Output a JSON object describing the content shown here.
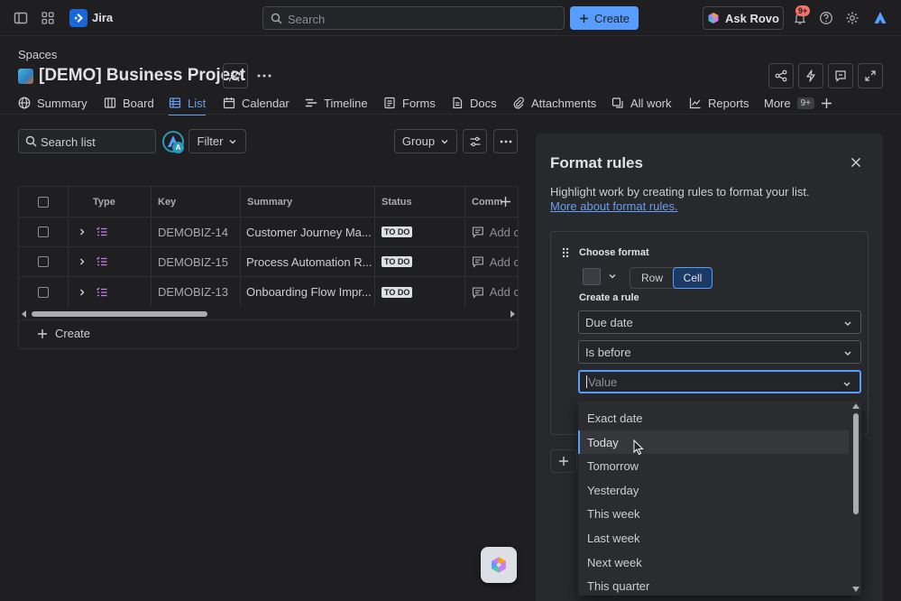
{
  "topbar": {
    "app_name": "Jira",
    "search_placeholder": "Search",
    "create_label": "Create",
    "ask_rovo_label": "Ask Rovo",
    "notification_count": "9+"
  },
  "header": {
    "spaces_label": "Spaces",
    "project_title": "[DEMO] Business Project"
  },
  "tabs": [
    {
      "label": "Summary",
      "icon": "globe-icon"
    },
    {
      "label": "Board",
      "icon": "board-icon"
    },
    {
      "label": "List",
      "icon": "list-icon",
      "active": true
    },
    {
      "label": "Calendar",
      "icon": "calendar-icon"
    },
    {
      "label": "Timeline",
      "icon": "timeline-icon"
    },
    {
      "label": "Forms",
      "icon": "forms-icon"
    },
    {
      "label": "Docs",
      "icon": "docs-icon"
    },
    {
      "label": "Attachments",
      "icon": "paperclip-icon"
    },
    {
      "label": "All work",
      "icon": "all-work-icon"
    },
    {
      "label": "Reports",
      "icon": "reports-icon"
    },
    {
      "label": "More",
      "badge": "9+"
    }
  ],
  "toolbar": {
    "search_placeholder": "Search list",
    "avatar_letter": "A",
    "filter_label": "Filter",
    "group_label": "Group"
  },
  "table": {
    "columns": [
      "Type",
      "Key",
      "Summary",
      "Status",
      "Comm"
    ],
    "rows": [
      {
        "key": "DEMOBIZ-14",
        "summary": "Customer Journey Ma...",
        "status": "TO DO",
        "comment": "Add c"
      },
      {
        "key": "DEMOBIZ-15",
        "summary": "Process Automation R...",
        "status": "TO DO",
        "comment": "Add c"
      },
      {
        "key": "DEMOBIZ-13",
        "summary": "Onboarding Flow Impr...",
        "status": "TO DO",
        "comment": "Add c"
      }
    ],
    "create_label": "Create"
  },
  "format_panel": {
    "title": "Format rules",
    "description": "Highlight work by creating rules to format your list.",
    "link": "More about format rules.",
    "choose_format_label": "Choose format",
    "row_label": "Row",
    "cell_label": "Cell",
    "create_rule_label": "Create a rule",
    "field_value": "Due date",
    "condition_value": "Is before",
    "value_placeholder": "Value"
  },
  "dropdown": {
    "options": [
      "Exact date",
      "Today",
      "Tomorrow",
      "Yesterday",
      "This week",
      "Last week",
      "Next week",
      "This quarter"
    ],
    "hovered": "Today"
  },
  "colors": {
    "accent": "#579dff",
    "background": "#1f1f21",
    "panel": "#28292c",
    "link": "#669df1"
  }
}
